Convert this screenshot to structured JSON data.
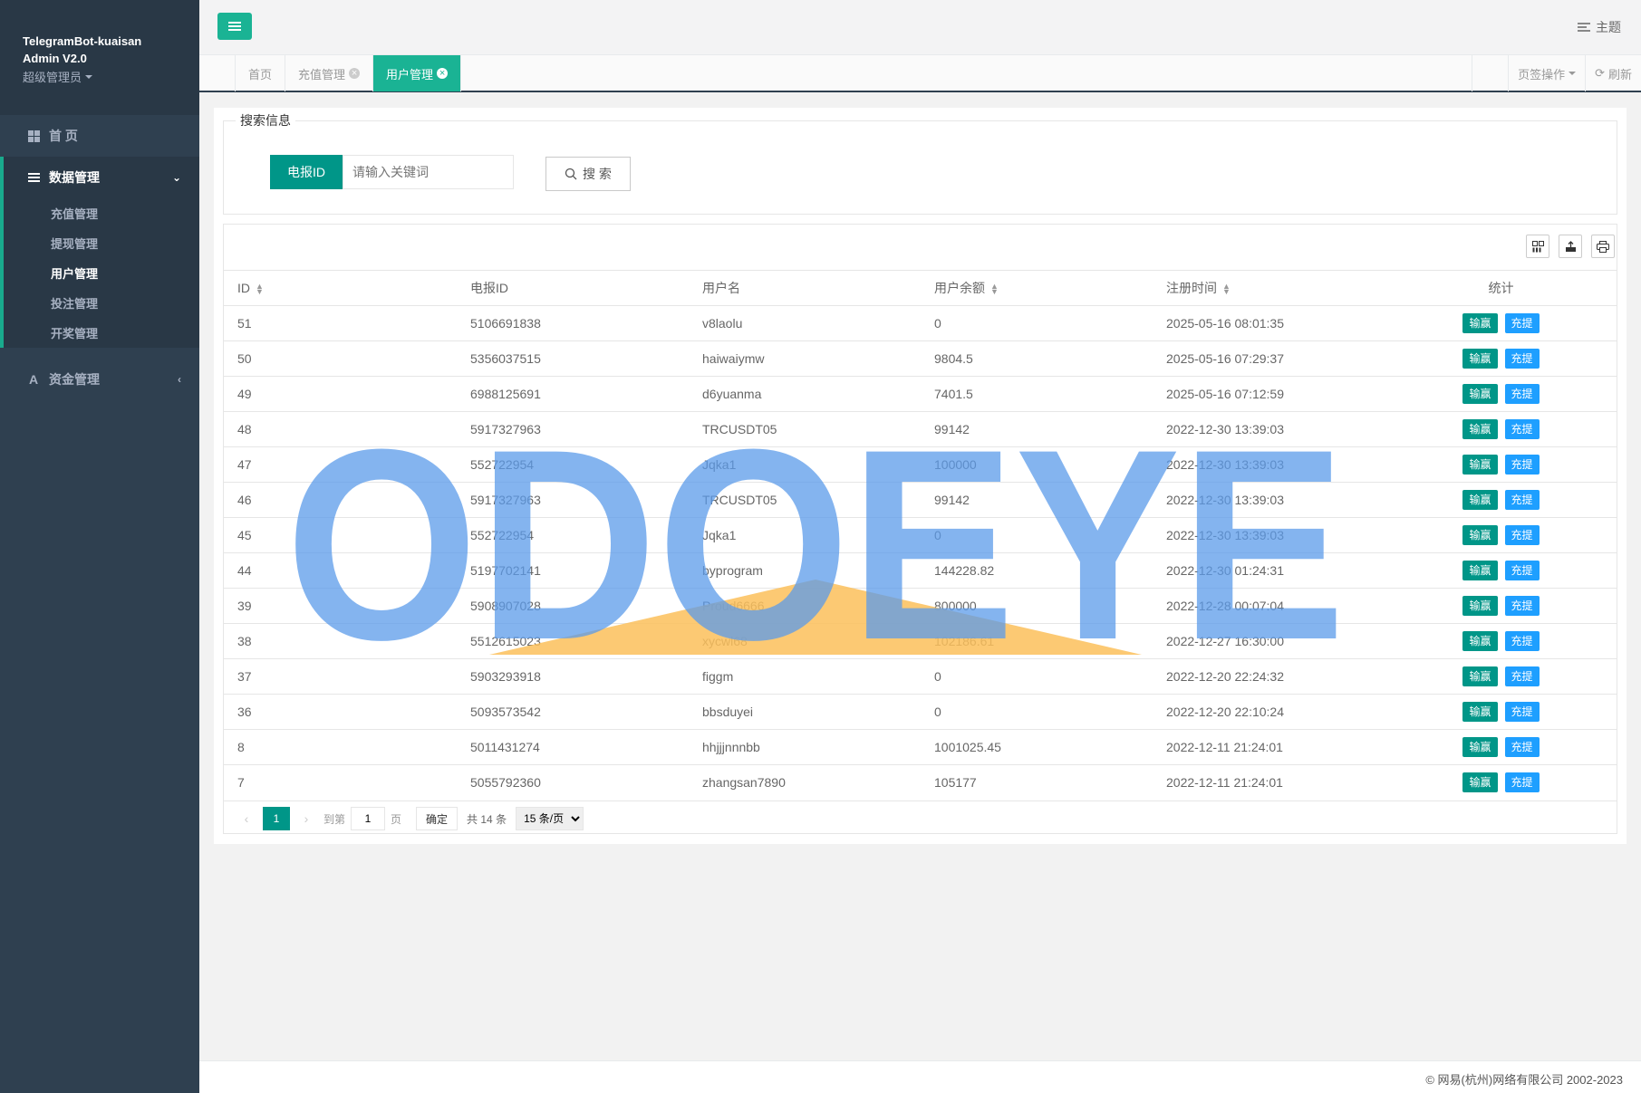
{
  "brand": {
    "line1": "TelegramBot-kuaisan",
    "line2": "Admin V2.0",
    "role": "超级管理员"
  },
  "nav": {
    "home": "首 页",
    "data_group": "数据管理",
    "sub": [
      "充值管理",
      "提现管理",
      "用户管理",
      "投注管理",
      "开奖管理"
    ],
    "fund": "资金管理"
  },
  "topbar": {
    "theme": "主题"
  },
  "tabs": [
    "首页",
    "充值管理",
    "用户管理"
  ],
  "tab_ops": {
    "page_ops": "页签操作",
    "refresh": "刷新"
  },
  "search": {
    "legend": "搜索信息",
    "label": "电报ID",
    "placeholder": "请输入关键词",
    "button": "搜 索"
  },
  "table": {
    "columns": [
      "ID",
      "电报ID",
      "用户名",
      "用户余额",
      "注册时间",
      "统计"
    ],
    "op_win": "输赢",
    "op_charge": "充提",
    "rows": [
      [
        "51",
        "5106691838",
        "v8laolu",
        "0",
        "2025-05-16 08:01:35"
      ],
      [
        "50",
        "5356037515",
        "haiwaiymw",
        "9804.5",
        "2025-05-16 07:29:37"
      ],
      [
        "49",
        "6988125691",
        "d6yuanma",
        "7401.5",
        "2025-05-16 07:12:59"
      ],
      [
        "48",
        "5917327963",
        "TRCUSDT05",
        "99142",
        "2022-12-30 13:39:03"
      ],
      [
        "47",
        "552722954",
        "Jqka1",
        "100000",
        "2022-12-30 13:39:03"
      ],
      [
        "46",
        "5917327963",
        "TRCUSDT05",
        "99142",
        "2022-12-30 13:39:03"
      ],
      [
        "45",
        "552722954",
        "Jqka1",
        "0",
        "2022-12-30 13:39:03"
      ],
      [
        "44",
        "5197702141",
        "byprogram",
        "144228.82",
        "2022-12-30 01:24:31"
      ],
      [
        "39",
        "5908907028",
        "Proud6666",
        "800000",
        "2022-12-28 00:07:04"
      ],
      [
        "38",
        "5512615023",
        "xycwl68",
        "102186.61",
        "2022-12-27 16:30:00"
      ],
      [
        "37",
        "5903293918",
        "figgm",
        "0",
        "2022-12-20 22:24:32"
      ],
      [
        "36",
        "5093573542",
        "bbsduyei",
        "0",
        "2022-12-20 22:10:24"
      ],
      [
        "8",
        "5011431274",
        "hhjjjnnnbb",
        "1001025.45",
        "2022-12-11 21:24:01"
      ],
      [
        "7",
        "5055792360",
        "zhangsan7890",
        "105177",
        "2022-12-11 21:24:01"
      ]
    ]
  },
  "pager": {
    "current": "1",
    "goto": "到第",
    "page_input": "1",
    "page_unit": "页",
    "confirm": "确定",
    "total": "共 14 条",
    "per_page": "15 条/页"
  },
  "footer": "© 网易(杭州)网络有限公司 2002-2023",
  "watermark": "ODOEYE",
  "colors": {
    "accent": "#1ab394",
    "sidebar": "#2f4050",
    "charge": "#1e9fff",
    "win": "#009688"
  }
}
